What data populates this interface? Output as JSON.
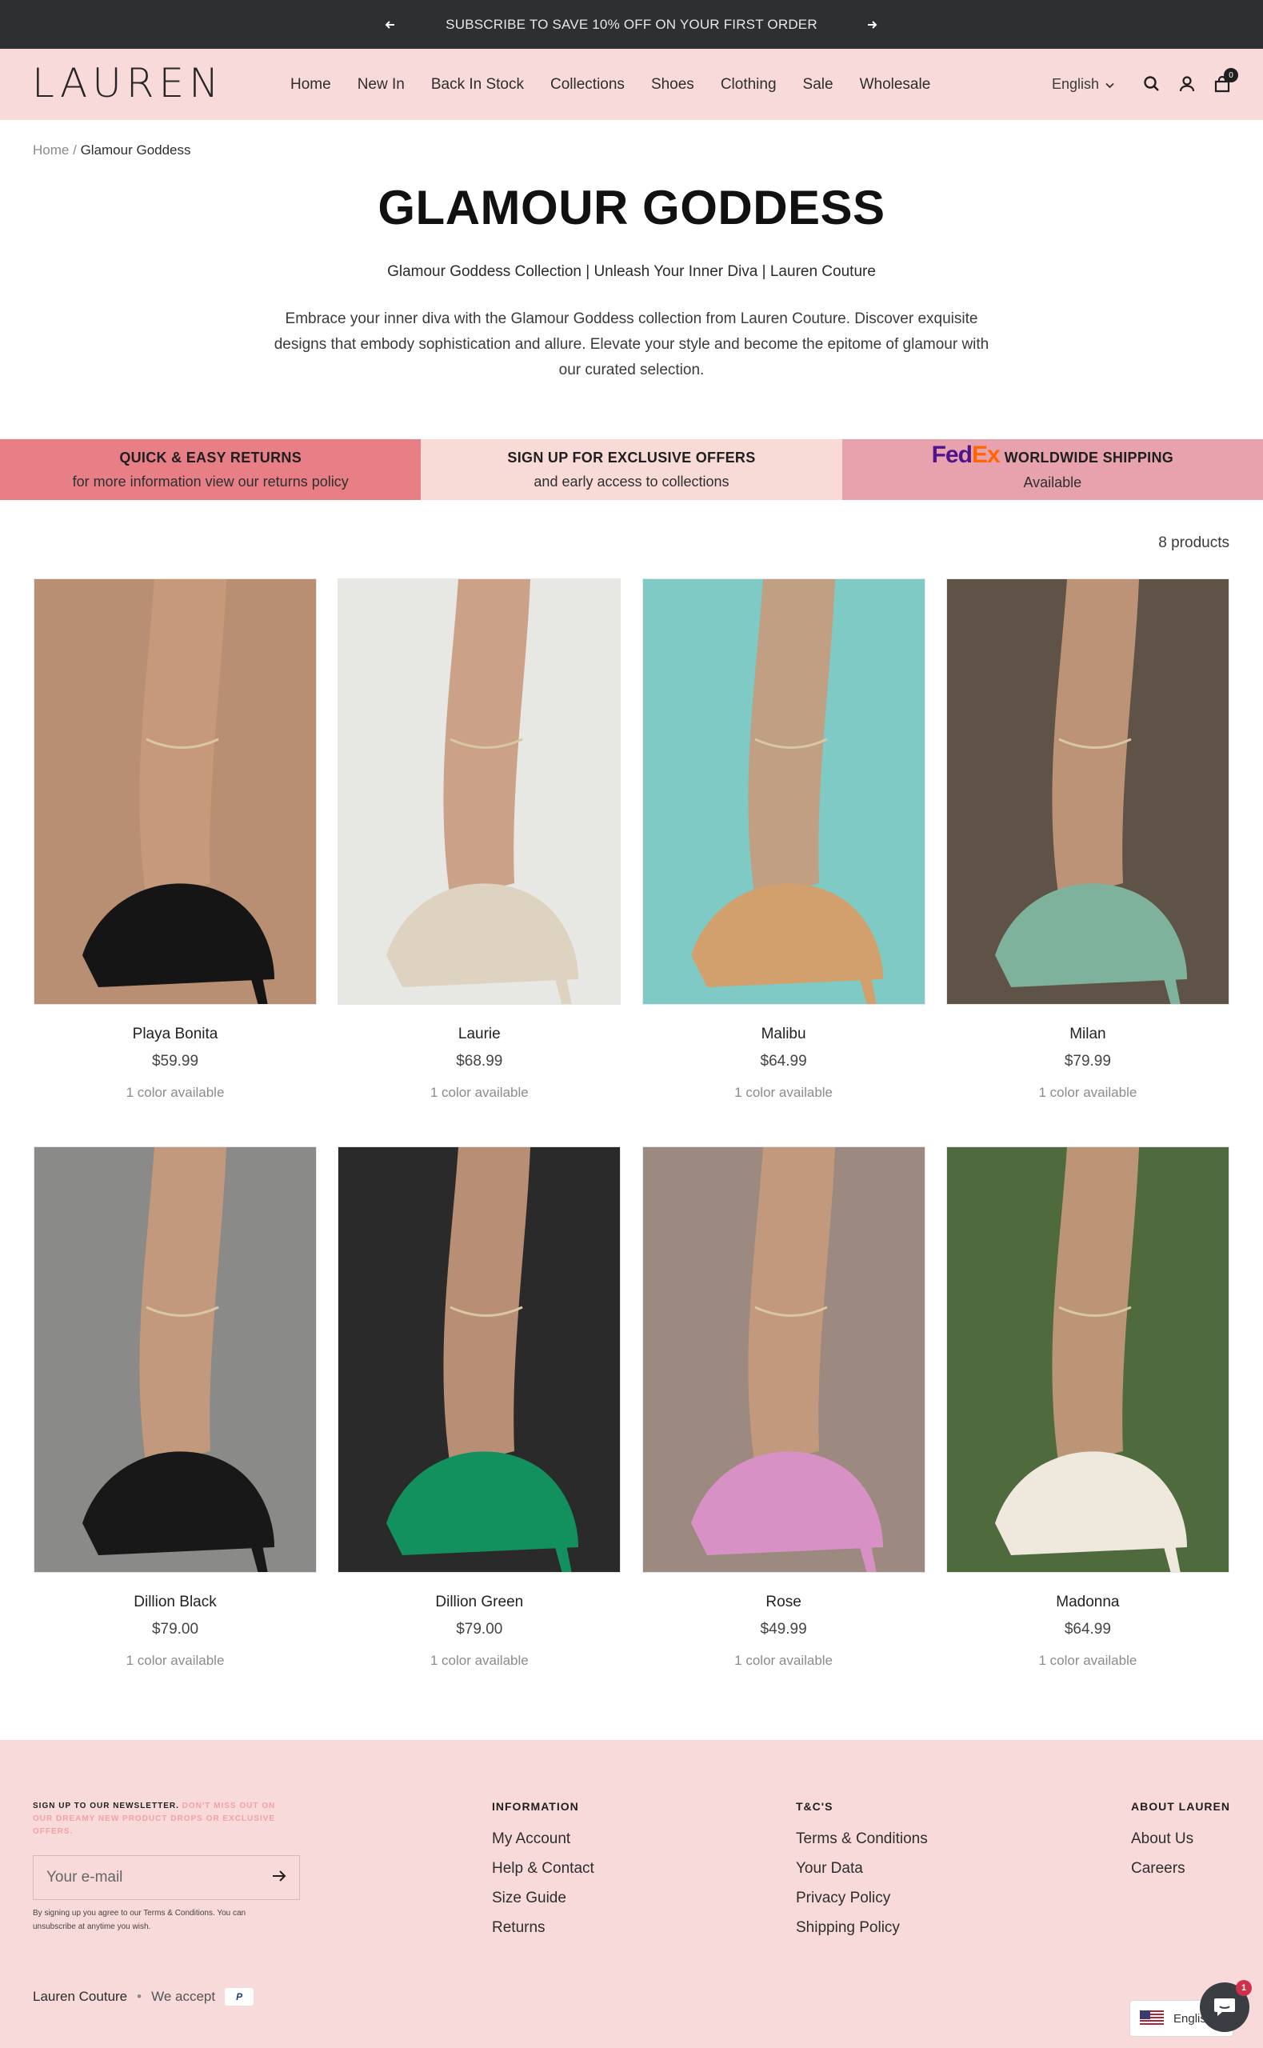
{
  "announcement": {
    "text": "SUBSCRIBE TO SAVE 10% OFF ON YOUR FIRST ORDER",
    "prev_icon": "arrow-left-icon",
    "next_icon": "arrow-right-icon"
  },
  "header": {
    "logo": "LAUREN",
    "nav": [
      "Home",
      "New In",
      "Back In Stock",
      "Collections",
      "Shoes",
      "Clothing",
      "Sale",
      "Wholesale"
    ],
    "language": "English",
    "cart_count": "0"
  },
  "breadcrumb": {
    "home": "Home",
    "separator": "/",
    "current": "Glamour Goddess"
  },
  "collection": {
    "title": "GLAMOUR GODDESS",
    "subtitle": "Glamour Goddess Collection | Unleash Your Inner Diva | Lauren Couture",
    "description": "Embrace your inner diva with the Glamour Goddess collection from Lauren Couture. Discover exquisite designs that embody sophistication and allure. Elevate your style and become the epitome of glamour with our curated selection."
  },
  "benefits": [
    {
      "title": "QUICK & EASY RETURNS",
      "text": "for more information view our returns policy"
    },
    {
      "title": "SIGN UP FOR EXCLUSIVE OFFERS",
      "text": "and early access to collections"
    },
    {
      "logo_fed": "Fed",
      "logo_ex": "Ex",
      "title": "WORLDWIDE SHIPPING",
      "text": "Available"
    }
  ],
  "product_count": "8 products",
  "products": [
    {
      "name": "Playa Bonita",
      "price": "$59.99",
      "colors": "1 color available",
      "shoe": "#151515",
      "bg": "#b98f74"
    },
    {
      "name": "Laurie",
      "price": "$68.99",
      "colors": "1 color available",
      "shoe": "#ddd3c0",
      "bg": "#e7e7e4"
    },
    {
      "name": "Malibu",
      "price": "$64.99",
      "colors": "1 color available",
      "shoe": "#d1a06c",
      "bg": "#7fcac4"
    },
    {
      "name": "Milan",
      "price": "$79.99",
      "colors": "1 color available",
      "shoe": "#7fb29c",
      "bg": "#5e5346"
    },
    {
      "name": "Dillion Black",
      "price": "$79.00",
      "colors": "1 color available",
      "shoe": "#181818",
      "bg": "#8a8a88"
    },
    {
      "name": "Dillion Green",
      "price": "$79.00",
      "colors": "1 color available",
      "shoe": "#12915f",
      "bg": "#2a2a2a"
    },
    {
      "name": "Rose",
      "price": "$49.99",
      "colors": "1 color available",
      "shoe": "#d891c4",
      "bg": "#9c8a80"
    },
    {
      "name": "Madonna",
      "price": "$64.99",
      "colors": "1 color available",
      "shoe": "#efe9dd",
      "bg": "#4f6a3c"
    }
  ],
  "footer": {
    "newsletter_title": "SIGN UP TO OUR NEWSLETTER.",
    "newsletter_accent": "DON'T MISS OUT ON OUR DREAMY NEW PRODUCT DROPS OR EXCLUSIVE OFFERS.",
    "email_placeholder": "Your e-mail",
    "newsletter_note": "By signing up you agree to our Terms & Conditions. You can unsubscribe at anytime you wish.",
    "columns": [
      {
        "title": "INFORMATION",
        "links": [
          "My Account",
          "Help & Contact",
          "Size Guide",
          "Returns"
        ]
      },
      {
        "title": "T&C'S",
        "links": [
          "Terms & Conditions",
          "Your Data",
          "Privacy Policy",
          "Shipping Policy"
        ]
      },
      {
        "title": "ABOUT LAUREN",
        "links": [
          "About Us",
          "Careers"
        ]
      }
    ],
    "brand": "Lauren Couture",
    "bullet": "•",
    "we_accept": "We accept",
    "payment": "P",
    "lang_pill": "English",
    "chat_badge": "1"
  }
}
